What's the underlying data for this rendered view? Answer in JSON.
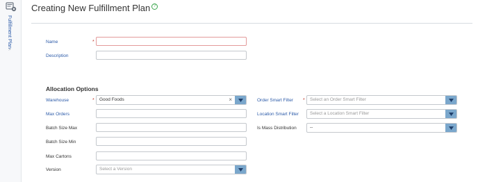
{
  "sidebar": {
    "label": "Fulfillment Plan",
    "icon": "fulfillment-plan-icon",
    "collapse_icon": "chevron-right-icon"
  },
  "page": {
    "title": "Creating New Fulfillment Plan",
    "help_icon": "help-icon"
  },
  "form": {
    "name": {
      "label": "Name",
      "required": true,
      "value": ""
    },
    "description": {
      "label": "Description",
      "value": ""
    }
  },
  "allocation": {
    "title": "Allocation Options",
    "warehouse": {
      "label": "Warehouse",
      "required": true,
      "value": "Good Foods",
      "clear": "×"
    },
    "max_orders": {
      "label": "Max Orders",
      "value": ""
    },
    "batch_size_max": {
      "label": "Batch Size Max",
      "value": ""
    },
    "batch_size_min": {
      "label": "Batch Size Min",
      "value": ""
    },
    "max_cartons": {
      "label": "Max Cartons",
      "value": ""
    },
    "version": {
      "label": "Version",
      "placeholder": "Select a Version"
    },
    "order_smart_filter": {
      "label": "Order Smart Filter",
      "required": true,
      "placeholder": "Select an Order Smart Filter"
    },
    "location_smart_filter": {
      "label": "Location Smart Filter",
      "placeholder": "Select a Location Smart Filter"
    },
    "is_mass_distribution": {
      "label": "Is Mass Distribution",
      "value": "--"
    }
  },
  "colors": {
    "accent": "#2b5aa8",
    "required": "#c0392b",
    "dropdown": "#7aa7cc",
    "help": "#3aa64c"
  }
}
